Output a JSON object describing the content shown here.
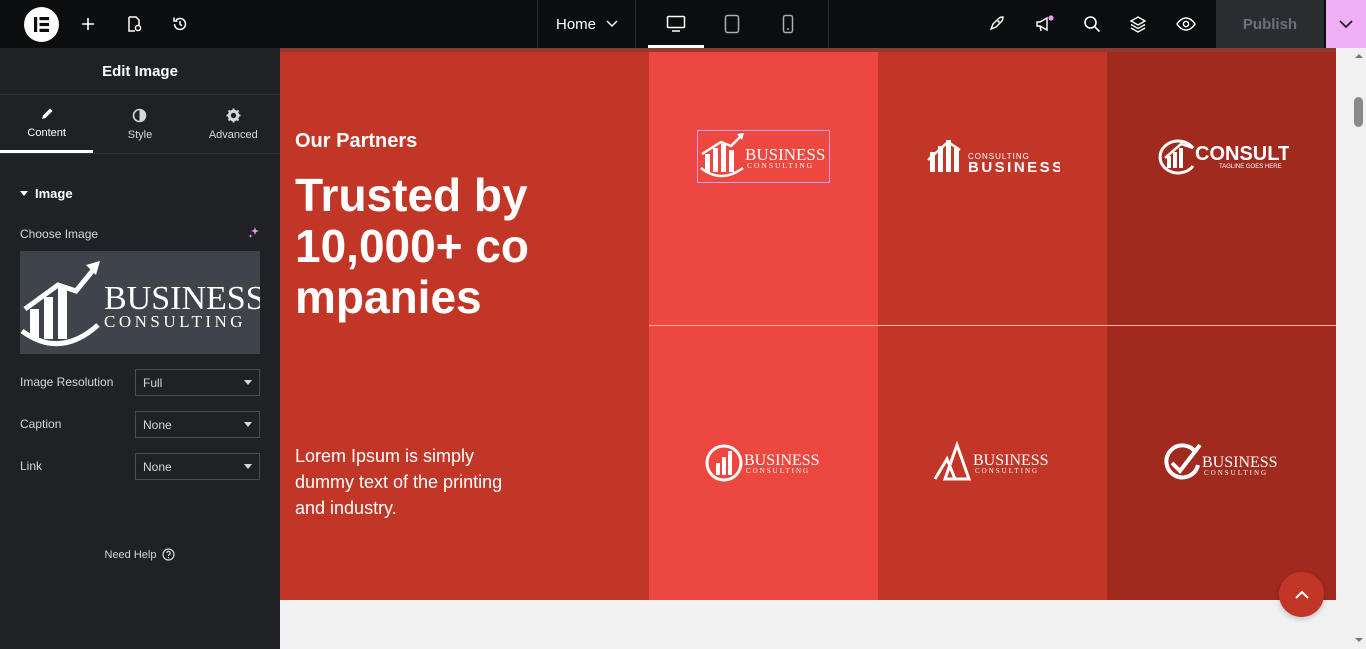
{
  "topbar": {
    "page_selector": "Home",
    "publish_label": "Publish",
    "icons": [
      "elementor-logo-icon",
      "plus-icon",
      "page-settings-icon",
      "history-icon",
      "chevron-down-icon",
      "desktop-icon",
      "tablet-icon",
      "mobile-icon",
      "rocket-icon",
      "megaphone-icon",
      "search-icon",
      "layers-icon",
      "eye-icon"
    ]
  },
  "panel": {
    "title": "Edit Image",
    "tabs": [
      {
        "label": "Content",
        "icon": "pencil-icon",
        "active": true
      },
      {
        "label": "Style",
        "icon": "half-circle-icon",
        "active": false
      },
      {
        "label": "Advanced",
        "icon": "gear-icon",
        "active": false
      }
    ],
    "section_title": "Image",
    "choose_image_label": "Choose Image",
    "preview_text": {
      "line1": "BUSINESS",
      "line2": "CONSULTING"
    },
    "controls": [
      {
        "label": "Image Resolution",
        "value": "Full"
      },
      {
        "label": "Caption",
        "value": "None"
      },
      {
        "label": "Link",
        "value": "None"
      }
    ],
    "need_help": "Need Help"
  },
  "canvas": {
    "eyebrow": "Our Partners",
    "heading": "Trusted by 10,000+ companies",
    "description": "Lorem Ipsum is simply dummy text of the printing and industry.",
    "logos": [
      {
        "name": "BUSINESS",
        "tag": "CONSULTING"
      },
      {
        "name": "BUSINESS",
        "tag": "CONSULTING"
      },
      {
        "name": "CONSULT",
        "tag": "TAGLINE GOES HERE"
      },
      {
        "name": "BUSINESS",
        "tag": "CONSULTING"
      },
      {
        "name": "BUSINESS",
        "tag": "CONSULTING"
      },
      {
        "name": "BUSINESS",
        "tag": "CONSULTING"
      }
    ]
  },
  "colors": {
    "section": "#c23628",
    "cell_light": "#ec4840",
    "cell_mid": "#c23628",
    "cell_dark": "#a12a1f",
    "publish_accent": "#f0aef5"
  }
}
